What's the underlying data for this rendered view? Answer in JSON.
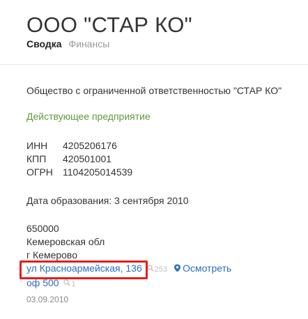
{
  "company": {
    "title": "ООО \"СТАР КО\"",
    "full_name": "Общество с ограниченной ответственностью \"СТАР КО\"",
    "status": "Действующее предприятие"
  },
  "tabs": [
    {
      "label": "Сводка",
      "active": true
    },
    {
      "label": "Финансы",
      "active": false
    }
  ],
  "codes": [
    {
      "key": "ИНН",
      "value": "4205206176"
    },
    {
      "key": "КПП",
      "value": "420501001"
    },
    {
      "key": "ОГРН",
      "value": "1104205014539"
    }
  ],
  "registration": {
    "label": "Дата образования: 3 сентября 2010"
  },
  "address": {
    "postal_code": "650000",
    "region": "Кемеровская обл",
    "city": "г Кемерово",
    "street": "ул Красноармейская, 136",
    "street_count": "253",
    "view_label": "Осмотреть",
    "office": "оф 500",
    "office_count": "1"
  },
  "update_date": "03.09.2010",
  "colors": {
    "link": "#2a6fc0",
    "status": "#5c9a3c",
    "highlight": "#e51c1c"
  },
  "icons": [
    "map-pin-icon",
    "magnifier-icon"
  ]
}
